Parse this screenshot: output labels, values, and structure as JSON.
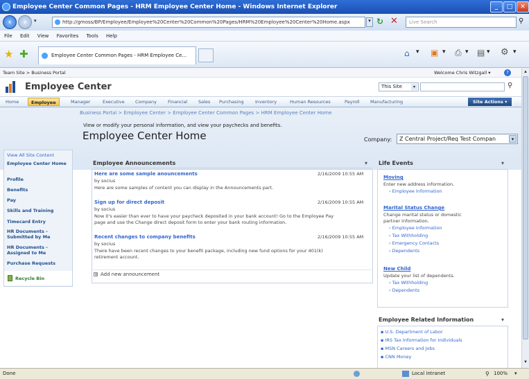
{
  "window": {
    "title": "Employee Center Common Pages - HRM Employee Center Home - Windows Internet Explorer"
  },
  "browser": {
    "url": "http://gmoss/BP/Employee/Employee%20Center%20Common%20Pages/HRM%20Employee%20Center%20Home.aspx",
    "search_placeholder": "Live Search",
    "menu": [
      "File",
      "Edit",
      "View",
      "Favorites",
      "Tools",
      "Help"
    ],
    "tab_label": "Employee Center Common Pages - HRM Employee Ce..."
  },
  "sp": {
    "breadcrumb_global": "Team Site > Business Portal",
    "welcome": "Welcome Chris Witzgall ▾",
    "site_title": "Employee Center",
    "search_scope": "This Site",
    "topnav": [
      "Home",
      "Employee",
      "Manager",
      "Executive",
      "Company",
      "Financial",
      "Sales",
      "Purchasing",
      "Inventory",
      "Human Resources",
      "Payroll",
      "Manufacturing"
    ],
    "site_actions": "Site Actions ▾",
    "breadcrumb": "Business Portal > Employee Center > Employee Center Common Pages > HRM Employee Center Home",
    "description": "View or modify your personal information, and view your paychecks and benefits.",
    "page_title": "Employee Center Home",
    "company_label": "Company:",
    "company_value": "Z Central Project/Req Test Compan",
    "quicklaunch": {
      "view_all": "View All Site Content",
      "items": [
        "Employee Center Home",
        "Profile",
        "Benefits",
        "Pay",
        "Skills and Training",
        "Timecard Entry",
        "HR Documents - Submitted by Me",
        "HR Documents - Assigned to Me",
        "Purchase Requests"
      ],
      "recycle": "Recycle Bin"
    },
    "announcements": {
      "title": "Employee Announcements",
      "items": [
        {
          "title": "Here are some sample anouncements",
          "by": "by socius",
          "date": "2/16/2009 10:55 AM",
          "body": "Here are some samples of content you can display in the Announcements part."
        },
        {
          "title": "Sign up for direct deposit",
          "by": "by socius",
          "date": "2/16/2009 10:55 AM",
          "body1": "Now it's easier than ever to have your paycheck deposited in your bank account! Go to the Employee Pay",
          "body2": "page and use the Change direct deposit form to enter your bank routing information."
        },
        {
          "title": "Recent changes to company benefits",
          "by": "by socius",
          "date": "2/16/2009 10:55 AM",
          "body1": "There have been recent changes to your benefit package, including new fund options for your 401(k)",
          "body2": "retirement account."
        }
      ],
      "add": "Add new announcement"
    },
    "life_events": {
      "title": "Life Events",
      "moving": {
        "title": "Moving",
        "desc": "Enter new address information.",
        "links": [
          "Employee Information"
        ]
      },
      "marital": {
        "title": "Marital Status Change",
        "desc1": "Change marital status or domestic",
        "desc2": "partner information.",
        "links": [
          "Employee Information",
          "Tax Withholding",
          "Emergency Contacts",
          "Dependents"
        ]
      },
      "child": {
        "title": "New Child",
        "desc": "Update your list of dependents.",
        "links": [
          "Tax Withholding",
          "Dependents"
        ]
      }
    },
    "related": {
      "title": "Employee Related Information",
      "links": [
        "U.S. Department of Labor",
        "IRS Tax Information for Individuals",
        "MSN Careers and Jobs",
        "CNN Money"
      ]
    }
  },
  "status": {
    "left": "Done",
    "zone": "Local intranet",
    "zoom": "100%"
  }
}
